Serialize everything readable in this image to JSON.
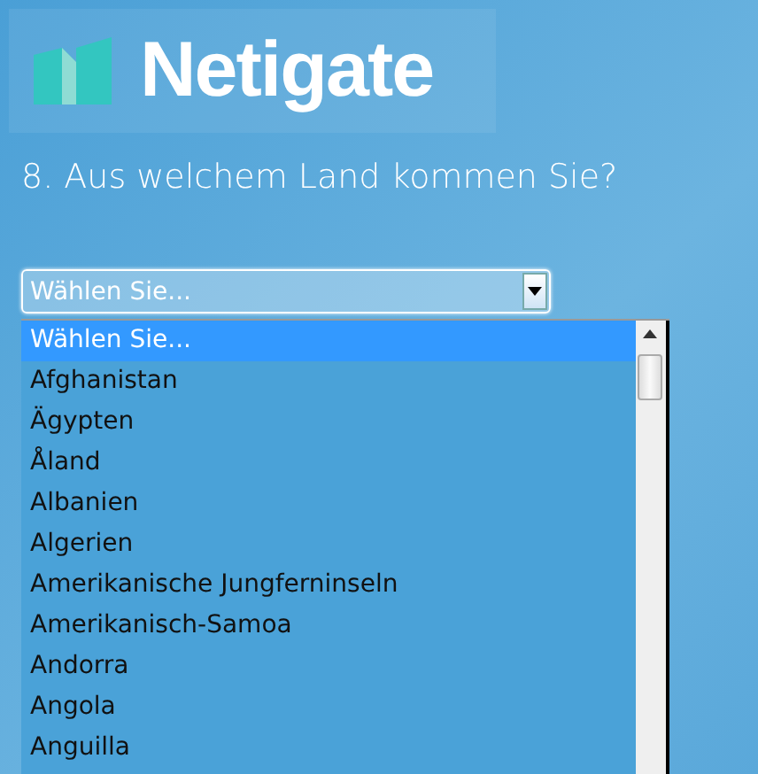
{
  "logo": {
    "text": "Netigate"
  },
  "question": "8. Aus welchem Land kommen Sie?",
  "select": {
    "value": "Wählen Sie...",
    "expanded": true
  },
  "options": [
    {
      "label": "Wählen Sie...",
      "selected": true
    },
    {
      "label": "Afghanistan",
      "selected": false
    },
    {
      "label": "Ägypten",
      "selected": false
    },
    {
      "label": "Åland",
      "selected": false
    },
    {
      "label": "Albanien",
      "selected": false
    },
    {
      "label": "Algerien",
      "selected": false
    },
    {
      "label": "Amerikanische Jungferninseln",
      "selected": false
    },
    {
      "label": "Amerikanisch-Samoa",
      "selected": false
    },
    {
      "label": "Andorra",
      "selected": false
    },
    {
      "label": "Angola",
      "selected": false
    },
    {
      "label": "Anguilla",
      "selected": false
    }
  ]
}
